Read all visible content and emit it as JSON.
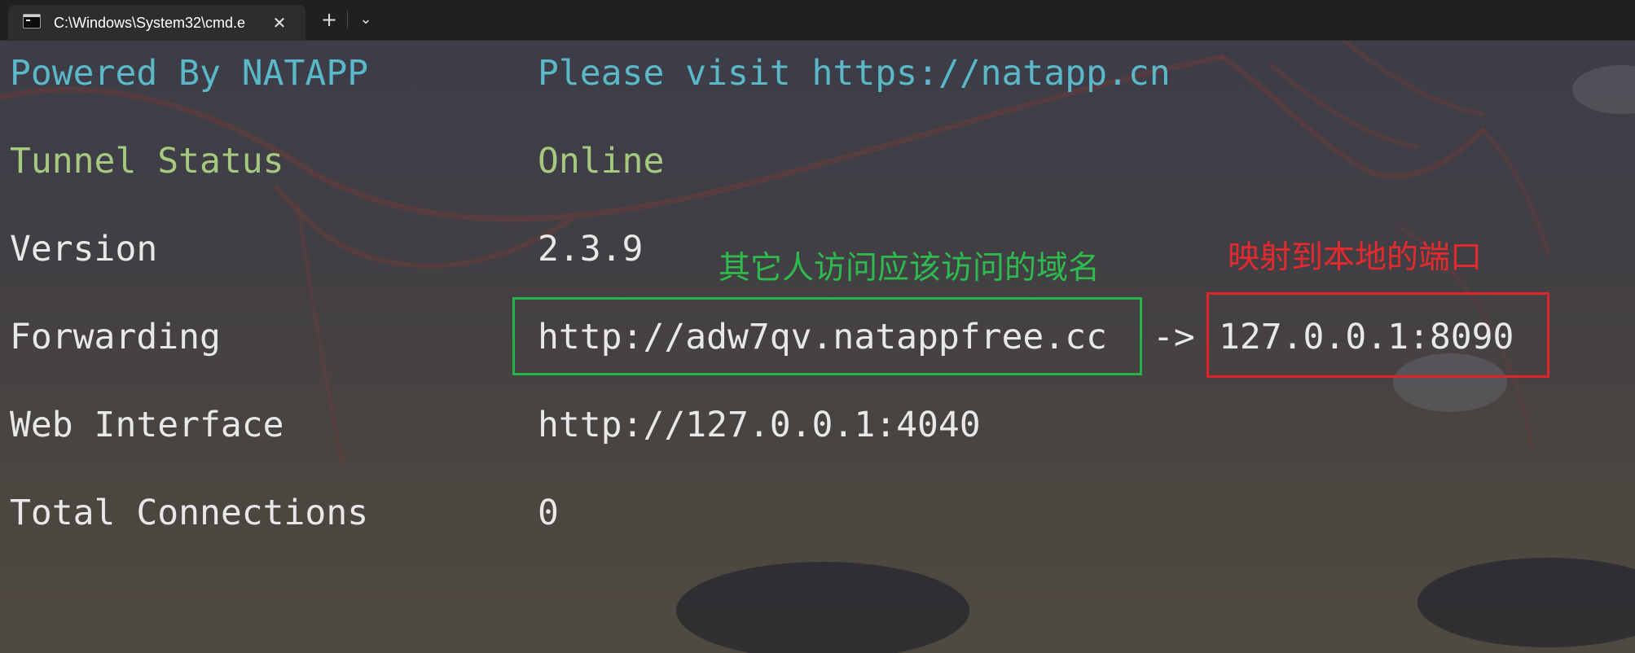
{
  "window": {
    "tab_title": "C:\\Windows\\System32\\cmd.e",
    "new_tab_label": "+",
    "close_label": "✕",
    "dropdown_label": "⌄"
  },
  "terminal": {
    "rows": [
      {
        "label": "Powered By NATAPP",
        "value": "Please visit https://natapp.cn"
      },
      {
        "label": "Tunnel Status",
        "value": "Online"
      },
      {
        "label": "Version",
        "value": "2.3.9"
      },
      {
        "label": "Forwarding",
        "value": "http://adw7qv.natappfree.cc",
        "arrow": "->",
        "target": "127.0.0.1:8090"
      },
      {
        "label": "Web Interface",
        "value": "http://127.0.0.1:4040"
      },
      {
        "label": "Total Connections",
        "value": "0"
      }
    ]
  },
  "annotations": {
    "domain_note": "其它人访问应该访问的域名",
    "port_note": "映射到本地的端口",
    "domain_color": "#27b34a",
    "port_color": "#e0242a"
  },
  "colors": {
    "banner": "#5ab8c8",
    "status": "#a6c87f",
    "text": "#e8e8e8"
  }
}
